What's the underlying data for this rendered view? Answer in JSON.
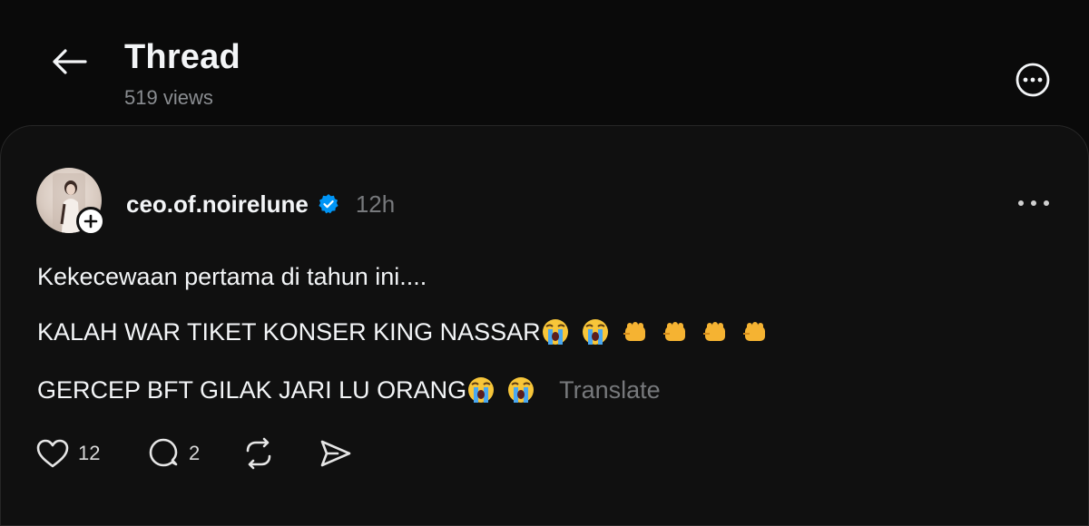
{
  "header": {
    "title": "Thread",
    "views": "519 views"
  },
  "post": {
    "username": "ceo.of.noirelune",
    "verified": true,
    "time": "12h",
    "lines": [
      "Kekecewaan pertama di tahun ini....",
      "KALAH WAR TIKET KONSER KING NASSAR",
      "GERCEP BFT GILAK JARI LU ORANG"
    ],
    "translate_label": "Translate",
    "likes": "12",
    "replies": "2"
  },
  "icons": {
    "back": "arrow-left-icon",
    "more": "more-circle-icon",
    "post_more": "ellipsis-icon",
    "follow": "plus-icon",
    "verified": "verified-badge-icon",
    "like": "heart-icon",
    "reply": "comment-icon",
    "repost": "repost-icon",
    "share": "send-icon",
    "emoji_cry": "loudly-crying-face-icon",
    "emoji_fist": "oncoming-fist-icon"
  },
  "colors": {
    "background": "#0a0a0a",
    "card": "#101010",
    "text": "#f3f5f7",
    "muted": "#77797c",
    "verified": "#0095f6"
  }
}
